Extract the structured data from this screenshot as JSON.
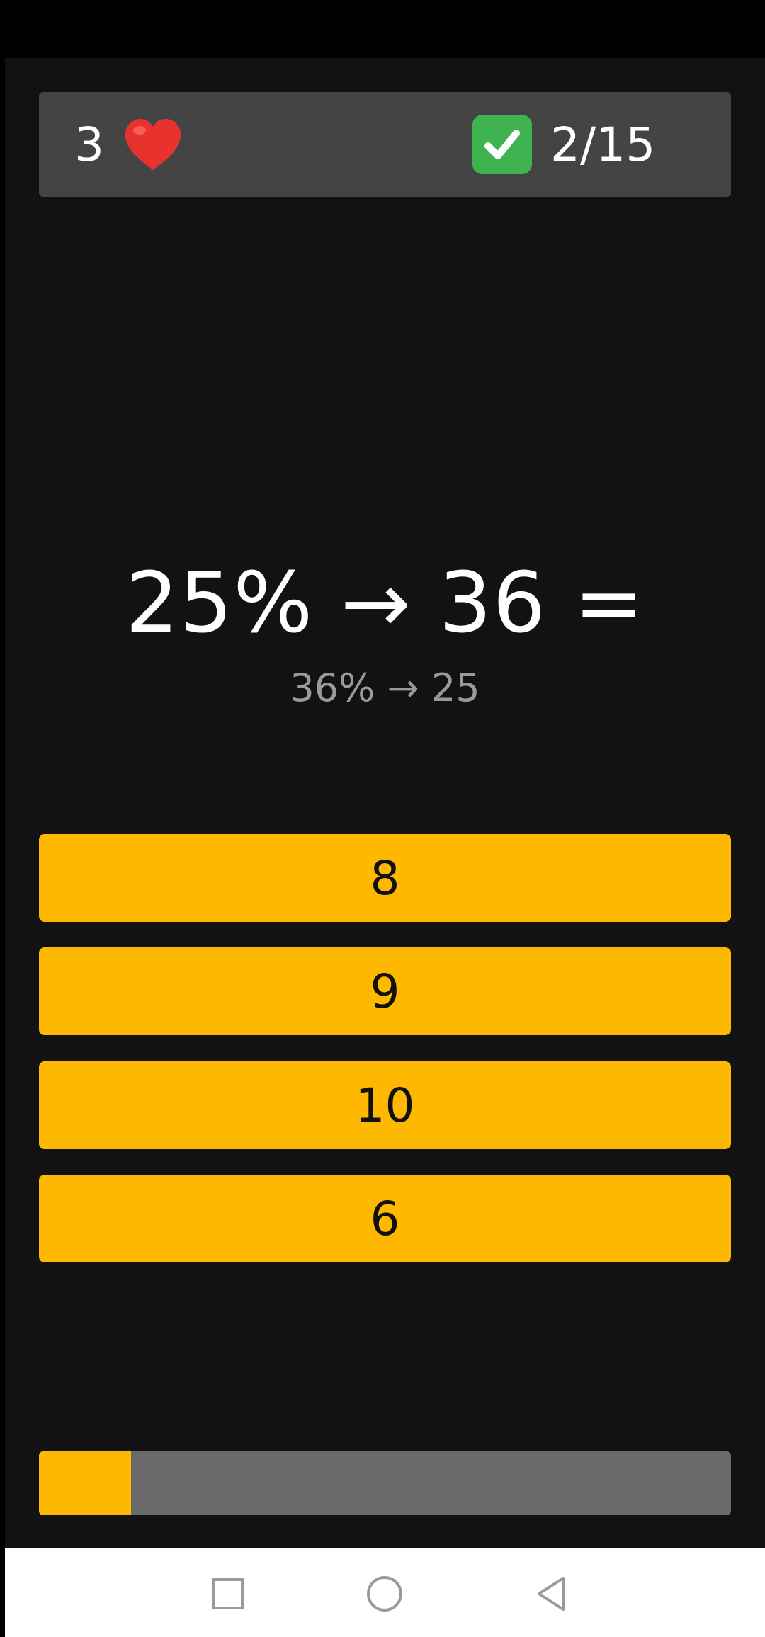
{
  "header": {
    "lives": "3",
    "lives_icon": "heart-icon",
    "score_icon": "check-mark-button-icon",
    "score": "2/15"
  },
  "question": {
    "text": "25% → 36 =",
    "hint": "36% → 25"
  },
  "answers": [
    {
      "label": "8"
    },
    {
      "label": "9"
    },
    {
      "label": "10"
    },
    {
      "label": "6"
    }
  ],
  "progress": {
    "fraction": 0.1333
  },
  "colors": {
    "accent": "#ffb800",
    "background": "#121212",
    "header_bg": "#444444",
    "track": "#6a6a6a",
    "heart": "#e8322d",
    "check": "#3fb34f"
  },
  "nav": {
    "recents_icon": "square-icon",
    "home_icon": "circle-icon",
    "back_icon": "triangle-back-icon"
  }
}
